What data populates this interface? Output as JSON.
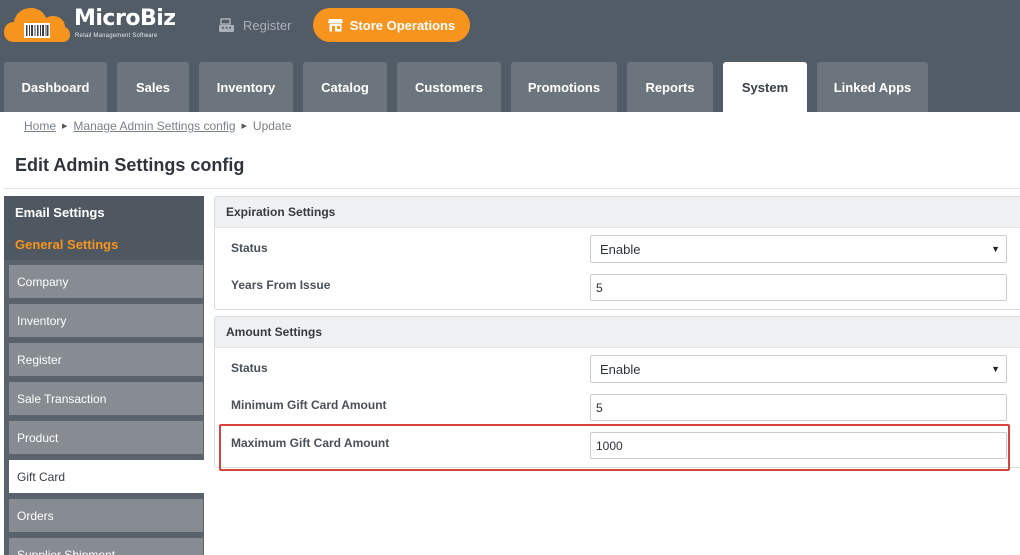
{
  "brand": {
    "name": "MicroBiz",
    "tagline": "Retail Management Software",
    "accent": "#f7941d"
  },
  "header": {
    "register_label": "Register",
    "store_operations_label": "Store Operations"
  },
  "nav": {
    "tabs": [
      {
        "label": "Dashboard"
      },
      {
        "label": "Sales"
      },
      {
        "label": "Inventory"
      },
      {
        "label": "Catalog"
      },
      {
        "label": "Customers"
      },
      {
        "label": "Promotions"
      },
      {
        "label": "Reports"
      },
      {
        "label": "System",
        "active": true
      },
      {
        "label": "Linked Apps"
      }
    ]
  },
  "breadcrumb": {
    "home": "Home",
    "parent": "Manage Admin Settings config",
    "current": "Update"
  },
  "page": {
    "title": "Edit Admin Settings config"
  },
  "sidebar": {
    "sections": [
      {
        "label": "Email Settings",
        "color": "#ffffff"
      },
      {
        "label": "General Settings",
        "color": "#f7941d"
      }
    ],
    "items": [
      {
        "label": "Company"
      },
      {
        "label": "Inventory"
      },
      {
        "label": "Register"
      },
      {
        "label": "Sale Transaction"
      },
      {
        "label": "Product"
      },
      {
        "label": "Gift Card",
        "active": true
      },
      {
        "label": "Orders"
      },
      {
        "label": "Supplier Shipment"
      }
    ]
  },
  "expiration_settings": {
    "title": "Expiration Settings",
    "status_label": "Status",
    "status_value": "Enable",
    "years_label": "Years From Issue",
    "years_value": "5"
  },
  "amount_settings": {
    "title": "Amount Settings",
    "status_label": "Status",
    "status_value": "Enable",
    "min_label": "Minimum Gift Card Amount",
    "min_value": "5",
    "max_label": "Maximum Gift Card Amount",
    "max_value": "1000",
    "highlight_color": "#d9443a"
  }
}
